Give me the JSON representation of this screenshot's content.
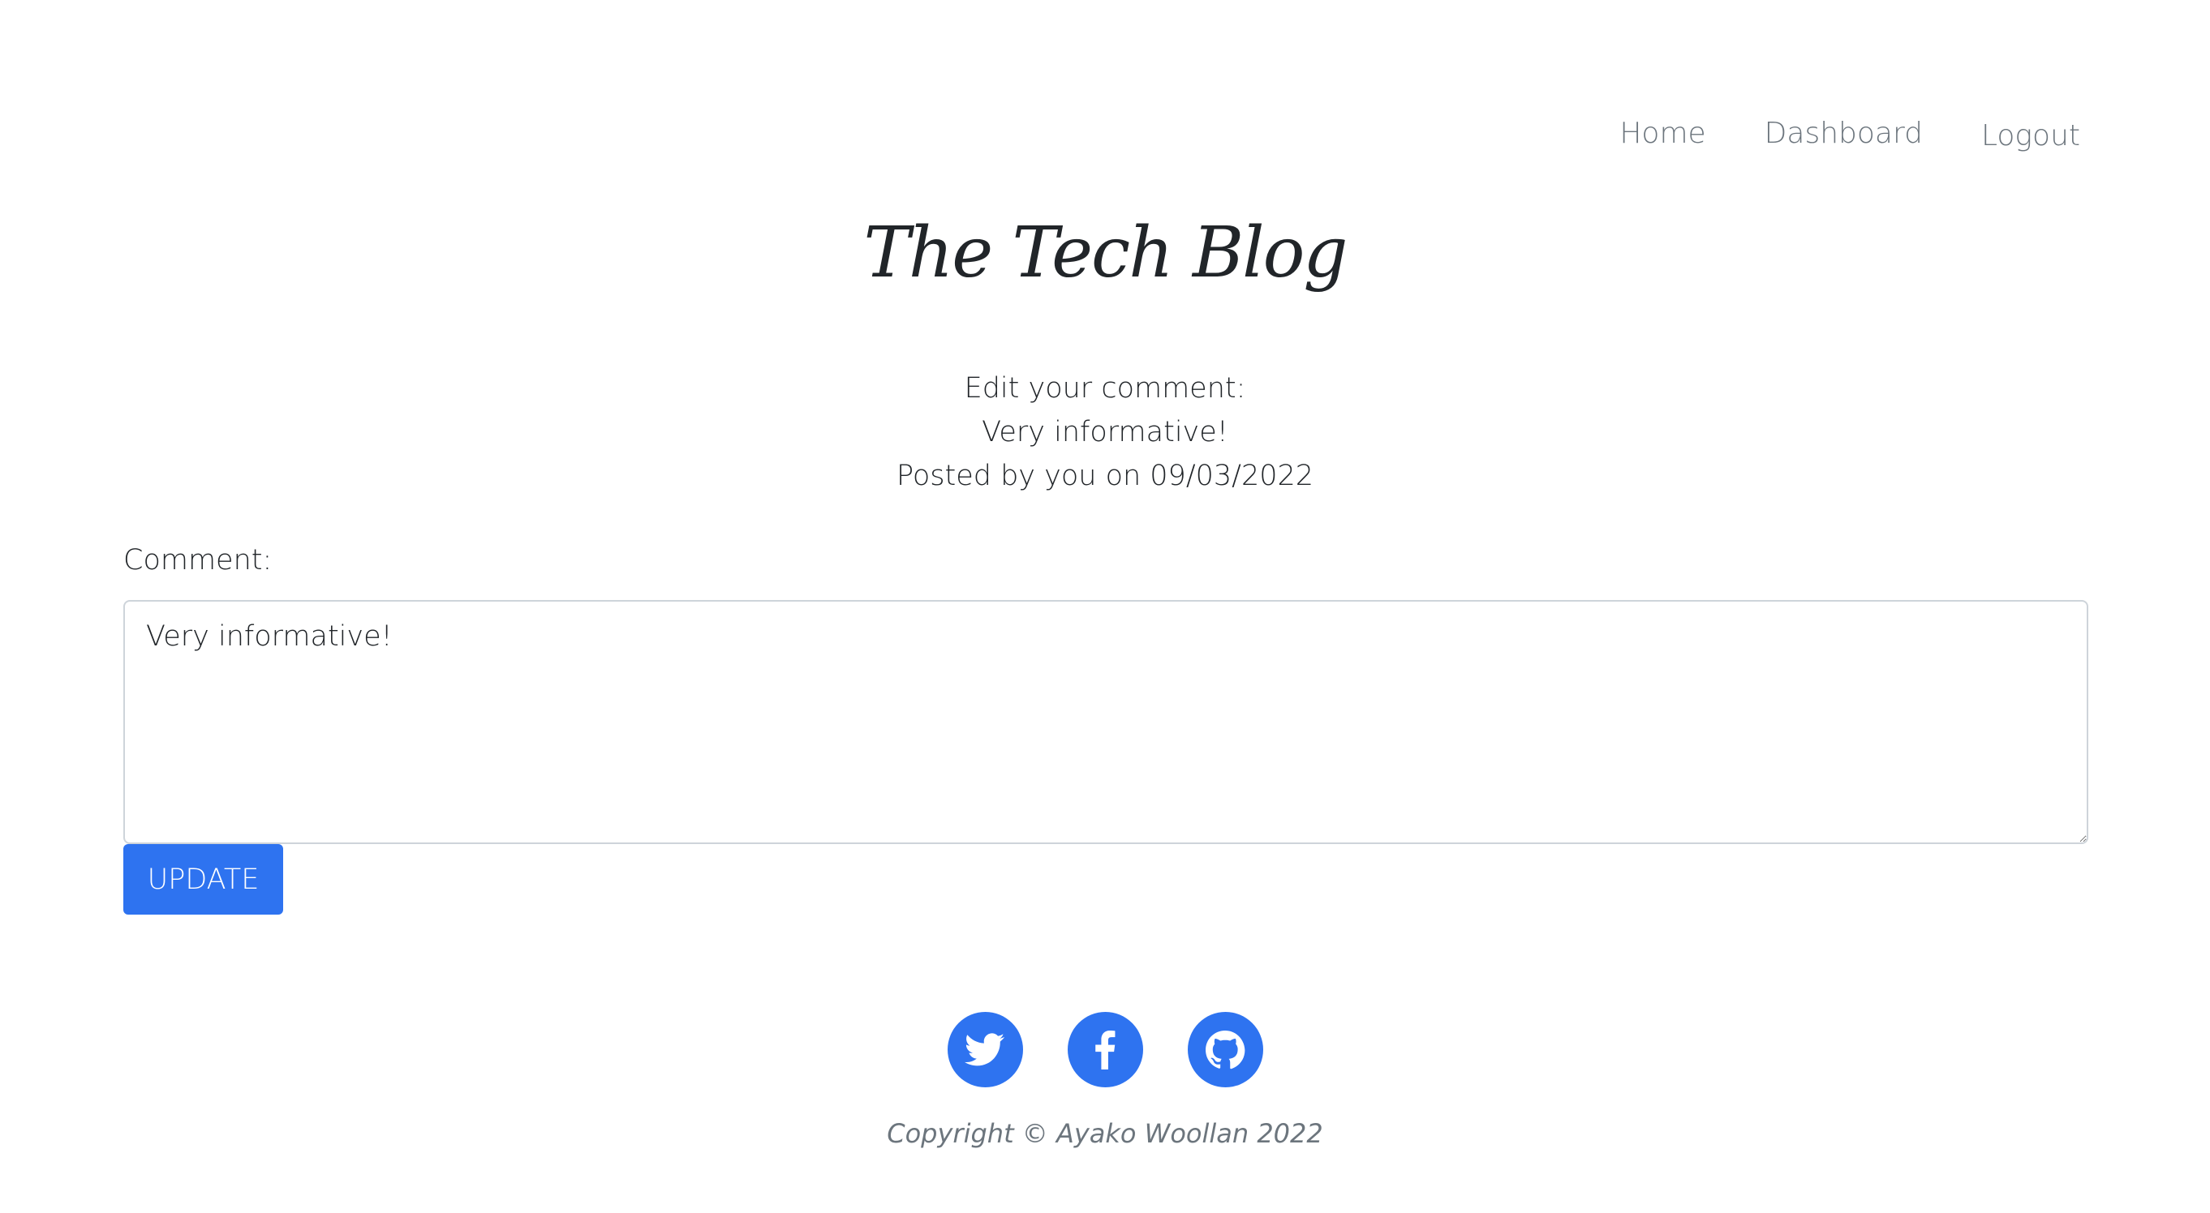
{
  "nav": {
    "home": "Home",
    "dashboard": "Dashboard",
    "logout": "Logout"
  },
  "brand": {
    "title": "The Tech Blog"
  },
  "comment_info": {
    "heading": "Edit your comment:",
    "text": "Very informative!",
    "posted": "Posted by you on 09/03/2022"
  },
  "form": {
    "label": "Comment:",
    "value": "Very informative!",
    "button": "UPDATE"
  },
  "social": {
    "icons": [
      "twitter-icon",
      "facebook-icon",
      "github-icon"
    ]
  },
  "footer": {
    "copyright": "Copyright © Ayako Woollan 2022"
  },
  "colors": {
    "accent": "#2e73f0",
    "muted": "#6c757d",
    "text": "#212529"
  }
}
